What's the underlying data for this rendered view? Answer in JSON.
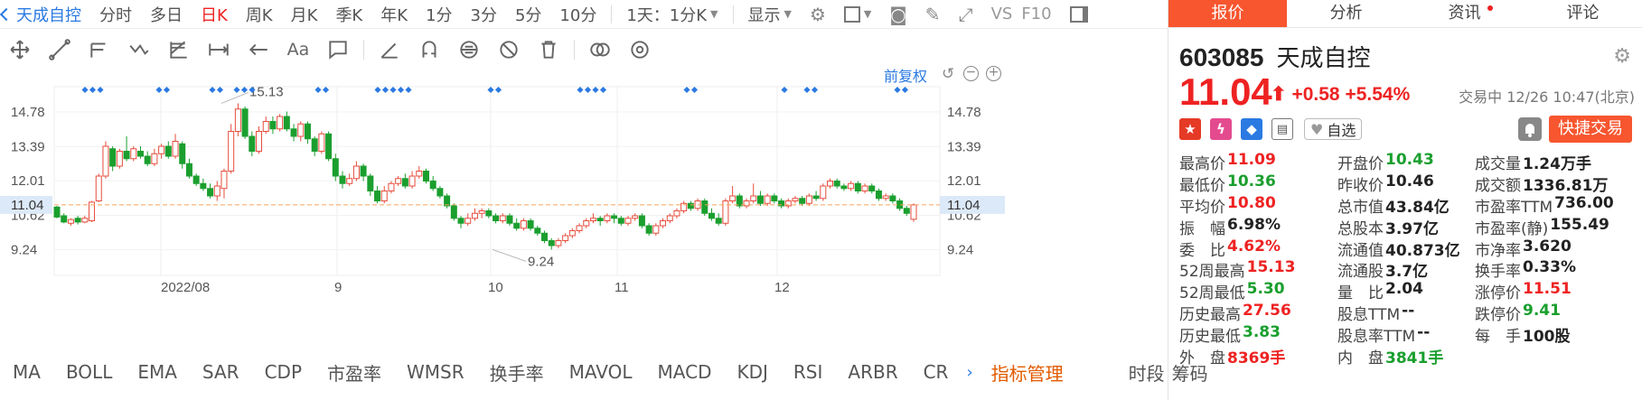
{
  "toolbar1": {
    "stock_name": "天成自控",
    "items": [
      "分时",
      "多日",
      "日K",
      "周K",
      "月K",
      "季K",
      "年K",
      "1分",
      "3分",
      "5分",
      "10分"
    ],
    "active": "日K",
    "combo": "1天：1分K",
    "display": "显示",
    "vs": "VS",
    "f10": "F10"
  },
  "chart_data": {
    "type": "candlestick",
    "title": "",
    "adj_label": "前复权",
    "yticks": [
      14.78,
      13.39,
      12.01,
      10.62,
      9.24
    ],
    "ylim": [
      8.2,
      15.8
    ],
    "x_tick_labels": [
      "2022/08",
      "9",
      "10",
      "11",
      "12"
    ],
    "current_price": 11.04,
    "annotations": [
      {
        "label": "15.13",
        "value": 15.13
      },
      {
        "label": "9.24",
        "value": 9.24
      }
    ],
    "candles": [
      [
        10.95,
        10.55,
        11.0,
        10.5
      ],
      [
        10.6,
        10.35,
        10.7,
        10.3
      ],
      [
        10.3,
        10.45,
        10.5,
        10.2
      ],
      [
        10.5,
        10.35,
        10.6,
        10.25
      ],
      [
        10.35,
        10.5,
        10.6,
        10.3
      ],
      [
        10.4,
        11.15,
        11.2,
        10.35
      ],
      [
        11.2,
        12.2,
        12.3,
        11.15
      ],
      [
        12.2,
        13.4,
        13.6,
        12.1
      ],
      [
        13.3,
        12.6,
        13.4,
        12.4
      ],
      [
        12.6,
        13.2,
        13.3,
        12.5
      ],
      [
        13.2,
        12.9,
        13.8,
        12.8
      ],
      [
        12.9,
        13.3,
        13.4,
        12.8
      ],
      [
        13.2,
        13.0,
        13.4,
        12.9
      ],
      [
        13.0,
        12.7,
        13.2,
        12.6
      ],
      [
        12.7,
        13.1,
        13.3,
        12.6
      ],
      [
        13.1,
        13.4,
        13.5,
        12.9
      ],
      [
        13.4,
        13.0,
        13.6,
        12.9
      ],
      [
        13.0,
        13.6,
        13.9,
        12.9
      ],
      [
        13.5,
        12.7,
        13.6,
        12.5
      ],
      [
        12.7,
        12.2,
        12.9,
        12.1
      ],
      [
        12.2,
        11.9,
        12.3,
        11.8
      ],
      [
        11.9,
        11.7,
        12.1,
        11.6
      ],
      [
        11.7,
        11.4,
        11.9,
        11.3
      ],
      [
        11.4,
        11.8,
        12.0,
        11.2
      ],
      [
        11.7,
        12.4,
        12.5,
        11.3
      ],
      [
        12.4,
        14.0,
        14.3,
        12.3
      ],
      [
        14.0,
        14.9,
        15.13,
        13.8
      ],
      [
        14.9,
        13.8,
        15.0,
        13.7
      ],
      [
        13.8,
        13.2,
        14.0,
        13.0
      ],
      [
        13.2,
        14.0,
        14.2,
        13.1
      ],
      [
        14.0,
        14.4,
        14.6,
        13.9
      ],
      [
        14.4,
        14.1,
        14.6,
        13.9
      ],
      [
        14.1,
        14.6,
        14.7,
        14.0
      ],
      [
        14.6,
        14.1,
        14.8,
        14.0
      ],
      [
        14.1,
        13.8,
        14.3,
        13.6
      ],
      [
        13.8,
        14.3,
        14.4,
        13.6
      ],
      [
        14.3,
        13.7,
        14.4,
        13.5
      ],
      [
        13.7,
        13.2,
        13.8,
        13.0
      ],
      [
        13.2,
        13.9,
        14.0,
        13.1
      ],
      [
        13.9,
        12.9,
        14.0,
        12.8
      ],
      [
        12.9,
        12.2,
        13.1,
        12.0
      ],
      [
        12.2,
        11.9,
        12.4,
        11.7
      ],
      [
        11.9,
        12.1,
        12.3,
        11.8
      ],
      [
        12.1,
        12.6,
        12.8,
        12.0
      ],
      [
        12.6,
        12.2,
        12.7,
        12.0
      ],
      [
        12.2,
        11.6,
        12.3,
        11.4
      ],
      [
        11.6,
        11.2,
        11.8,
        11.1
      ],
      [
        11.2,
        11.6,
        11.8,
        11.1
      ],
      [
        11.6,
        11.9,
        12.0,
        11.5
      ],
      [
        11.9,
        12.1,
        12.2,
        11.8
      ],
      [
        12.1,
        11.8,
        12.3,
        11.7
      ],
      [
        11.8,
        12.2,
        12.4,
        11.7
      ],
      [
        12.2,
        12.4,
        12.6,
        12.1
      ],
      [
        12.4,
        12.0,
        12.5,
        11.9
      ],
      [
        12.0,
        11.7,
        12.2,
        11.6
      ],
      [
        11.7,
        11.4,
        11.8,
        11.3
      ],
      [
        11.4,
        11.0,
        11.5,
        10.9
      ],
      [
        11.0,
        10.5,
        11.1,
        10.4
      ],
      [
        10.5,
        10.3,
        10.6,
        10.1
      ],
      [
        10.3,
        10.5,
        10.7,
        10.2
      ],
      [
        10.5,
        10.7,
        10.9,
        10.4
      ],
      [
        10.7,
        10.8,
        10.9,
        10.5
      ],
      [
        10.8,
        10.6,
        10.9,
        10.5
      ],
      [
        10.6,
        10.4,
        10.7,
        10.3
      ],
      [
        10.4,
        10.6,
        10.7,
        10.3
      ],
      [
        10.6,
        10.3,
        10.7,
        10.2
      ],
      [
        10.3,
        10.1,
        10.5,
        10.0
      ],
      [
        10.1,
        10.4,
        10.5,
        10.0
      ],
      [
        10.4,
        10.1,
        10.5,
        10.0
      ],
      [
        10.1,
        9.9,
        10.2,
        9.8
      ],
      [
        9.9,
        9.6,
        10.0,
        9.5
      ],
      [
        9.6,
        9.4,
        9.7,
        9.24
      ],
      [
        9.4,
        9.6,
        9.7,
        9.3
      ],
      [
        9.6,
        9.8,
        9.9,
        9.5
      ],
      [
        9.8,
        10.0,
        10.1,
        9.7
      ],
      [
        10.0,
        10.2,
        10.3,
        9.9
      ],
      [
        10.2,
        10.4,
        10.5,
        10.1
      ],
      [
        10.4,
        10.5,
        10.7,
        10.3
      ],
      [
        10.5,
        10.4,
        10.6,
        10.2
      ],
      [
        10.4,
        10.6,
        10.7,
        10.3
      ],
      [
        10.6,
        10.5,
        10.7,
        10.3
      ],
      [
        10.5,
        10.3,
        10.6,
        10.2
      ],
      [
        10.3,
        10.5,
        10.6,
        10.2
      ],
      [
        10.5,
        10.6,
        10.7,
        10.4
      ],
      [
        10.6,
        10.2,
        10.7,
        10.1
      ],
      [
        10.2,
        9.9,
        10.3,
        9.8
      ],
      [
        9.9,
        10.2,
        10.3,
        9.8
      ],
      [
        10.2,
        10.4,
        10.5,
        10.1
      ],
      [
        10.4,
        10.6,
        10.7,
        10.3
      ],
      [
        10.6,
        10.8,
        10.9,
        10.5
      ],
      [
        10.8,
        11.1,
        11.2,
        10.7
      ],
      [
        11.1,
        10.9,
        11.2,
        10.8
      ],
      [
        10.9,
        11.2,
        11.3,
        10.8
      ],
      [
        11.2,
        10.7,
        11.3,
        10.6
      ],
      [
        10.7,
        10.5,
        10.9,
        10.4
      ],
      [
        10.5,
        10.3,
        10.7,
        10.2
      ],
      [
        10.3,
        11.2,
        11.3,
        10.2
      ],
      [
        11.2,
        11.4,
        11.8,
        11.1
      ],
      [
        11.4,
        11.0,
        11.5,
        10.9
      ],
      [
        11.0,
        11.2,
        11.3,
        10.9
      ],
      [
        11.2,
        11.4,
        11.9,
        11.1
      ],
      [
        11.4,
        11.1,
        11.6,
        11.0
      ],
      [
        11.1,
        11.4,
        11.5,
        11.0
      ],
      [
        11.4,
        11.2,
        11.5,
        11.1
      ],
      [
        11.2,
        11.0,
        11.3,
        10.9
      ],
      [
        11.0,
        11.2,
        11.3,
        10.9
      ],
      [
        11.2,
        11.3,
        11.4,
        11.1
      ],
      [
        11.3,
        11.1,
        11.4,
        11.0
      ],
      [
        11.1,
        11.4,
        11.5,
        11.0
      ],
      [
        11.4,
        11.3,
        11.6,
        11.2
      ],
      [
        11.3,
        11.8,
        11.9,
        11.2
      ],
      [
        11.8,
        12.0,
        12.1,
        11.7
      ],
      [
        12.0,
        11.8,
        12.1,
        11.7
      ],
      [
        11.8,
        11.7,
        11.9,
        11.6
      ],
      [
        11.7,
        11.9,
        12.0,
        11.6
      ],
      [
        11.9,
        11.6,
        12.0,
        11.5
      ],
      [
        11.6,
        11.8,
        11.9,
        11.5
      ],
      [
        11.8,
        11.6,
        11.9,
        11.5
      ],
      [
        11.6,
        11.3,
        11.7,
        11.2
      ],
      [
        11.3,
        11.4,
        11.5,
        11.2
      ],
      [
        11.4,
        11.2,
        11.5,
        11.1
      ],
      [
        11.2,
        10.9,
        11.3,
        10.8
      ],
      [
        10.9,
        10.7,
        11.0,
        10.6
      ],
      [
        10.46,
        11.04,
        11.09,
        10.36
      ]
    ]
  },
  "toolbar2": {
    "aa": "Aa"
  },
  "bottom_bar": {
    "items": [
      "MA",
      "BOLL",
      "EMA",
      "SAR",
      "CDP",
      "市盈率",
      "WMSR",
      "换手率",
      "MAVOL",
      "MACD",
      "KDJ",
      "RSI",
      "ARBR",
      "CR"
    ],
    "manage": "指标管理",
    "shiduan": "时段",
    "chouma": "筹码"
  },
  "tabs": [
    "报价",
    "分析",
    "资讯",
    "评论"
  ],
  "stock": {
    "code": "603085",
    "name": "天成自控",
    "price": "11.04",
    "change": "+0.58",
    "change_pct": "+5.54%",
    "status": "交易中 12/26 10:47(北京)",
    "watch": "自选",
    "trade": "快捷交易"
  },
  "quote": [
    [
      [
        "最高价",
        "11.09",
        "r"
      ],
      [
        "开盘价",
        "10.43",
        "g"
      ],
      [
        "成交量",
        "1.24万手",
        "k"
      ]
    ],
    [
      [
        "最低价",
        "10.36",
        "g"
      ],
      [
        "昨收价",
        "10.46",
        "k"
      ],
      [
        "成交额",
        "1336.81万",
        "k"
      ]
    ],
    [
      [
        "平均价",
        "10.80",
        "r"
      ],
      [
        "总市值",
        "43.84亿",
        "k"
      ],
      [
        "市盈率TTM",
        "736.00",
        "k"
      ]
    ],
    [
      [
        "振　幅",
        "6.98%",
        "k"
      ],
      [
        "总股本",
        "3.97亿",
        "k"
      ],
      [
        "市盈率(静)",
        "155.49",
        "k"
      ]
    ],
    [
      [
        "委　比",
        "4.62%",
        "r"
      ],
      [
        "流通值",
        "40.873亿",
        "k"
      ],
      [
        "市净率",
        "3.620",
        "k"
      ]
    ],
    [
      [
        "52周最高",
        "15.13",
        "r"
      ],
      [
        "流通股",
        "3.7亿",
        "k"
      ],
      [
        "换手率",
        "0.33%",
        "k"
      ]
    ],
    [
      [
        "52周最低",
        "5.30",
        "g"
      ],
      [
        "量　比",
        "2.04",
        "k"
      ],
      [
        "涨停价",
        "11.51",
        "r"
      ]
    ],
    [
      [
        "历史最高",
        "27.56",
        "r"
      ],
      [
        "股息TTM",
        "--",
        "k"
      ],
      [
        "跌停价",
        "9.41",
        "g"
      ]
    ],
    [
      [
        "历史最低",
        "3.83",
        "g"
      ],
      [
        "股息率TTM",
        "--",
        "k"
      ],
      [
        "每　手",
        "100股",
        "k"
      ]
    ],
    [
      [
        "外　盘",
        "8369手",
        "r"
      ],
      [
        "内　盘",
        "3841手",
        "g"
      ],
      [
        "",
        "",
        " k"
      ]
    ]
  ]
}
